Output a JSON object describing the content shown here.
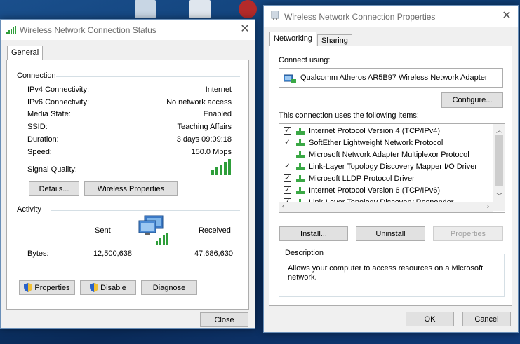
{
  "colors": {
    "accent": "#0078d7",
    "signal_green": "#2e9e3a",
    "network_green": "#3aa845"
  },
  "status_dialog": {
    "title": "Wireless Network Connection Status",
    "tab": "General",
    "connection": {
      "heading": "Connection",
      "rows": [
        {
          "label": "IPv4 Connectivity:",
          "value": "Internet"
        },
        {
          "label": "IPv6 Connectivity:",
          "value": "No network access"
        },
        {
          "label": "Media State:",
          "value": "Enabled"
        },
        {
          "label": "SSID:",
          "value": "Teaching Affairs"
        },
        {
          "label": "Duration:",
          "value": "3 days 09:09:18"
        },
        {
          "label": "Speed:",
          "value": "150.0 Mbps"
        }
      ],
      "signal_label": "Signal Quality:",
      "signal_bars": 5,
      "details_button": "Details...",
      "wireless_properties_button": "Wireless Properties"
    },
    "activity": {
      "heading": "Activity",
      "sent_label": "Sent",
      "received_label": "Received",
      "bytes_label": "Bytes:",
      "bytes_sent": "12,500,638",
      "bytes_received": "47,686,630"
    },
    "buttons": {
      "properties": "Properties",
      "disable": "Disable",
      "diagnose": "Diagnose",
      "close": "Close"
    }
  },
  "properties_dialog": {
    "title": "Wireless Network Connection Properties",
    "tabs": [
      "Networking",
      "Sharing"
    ],
    "connect_using_label": "Connect using:",
    "adapter_name": "Qualcomm Atheros AR5B97 Wireless Network Adapter",
    "configure_button": "Configure...",
    "items_label": "This connection uses the following items:",
    "items": [
      {
        "label": "Internet Protocol Version 4 (TCP/IPv4)",
        "checked": true
      },
      {
        "label": "SoftEther Lightweight Network Protocol",
        "checked": true
      },
      {
        "label": "Microsoft Network Adapter Multiplexor Protocol",
        "checked": false
      },
      {
        "label": "Link-Layer Topology Discovery Mapper I/O Driver",
        "checked": true
      },
      {
        "label": "Microsoft LLDP Protocol Driver",
        "checked": true
      },
      {
        "label": "Internet Protocol Version 6 (TCP/IPv6)",
        "checked": true
      },
      {
        "label": "Link-Layer Topology Discovery Responder",
        "checked": true
      }
    ],
    "install_button": "Install...",
    "uninstall_button": "Uninstall",
    "properties_button": "Properties",
    "description_heading": "Description",
    "description_text": "Allows your computer to access resources on a Microsoft network.",
    "ok_button": "OK",
    "cancel_button": "Cancel"
  }
}
